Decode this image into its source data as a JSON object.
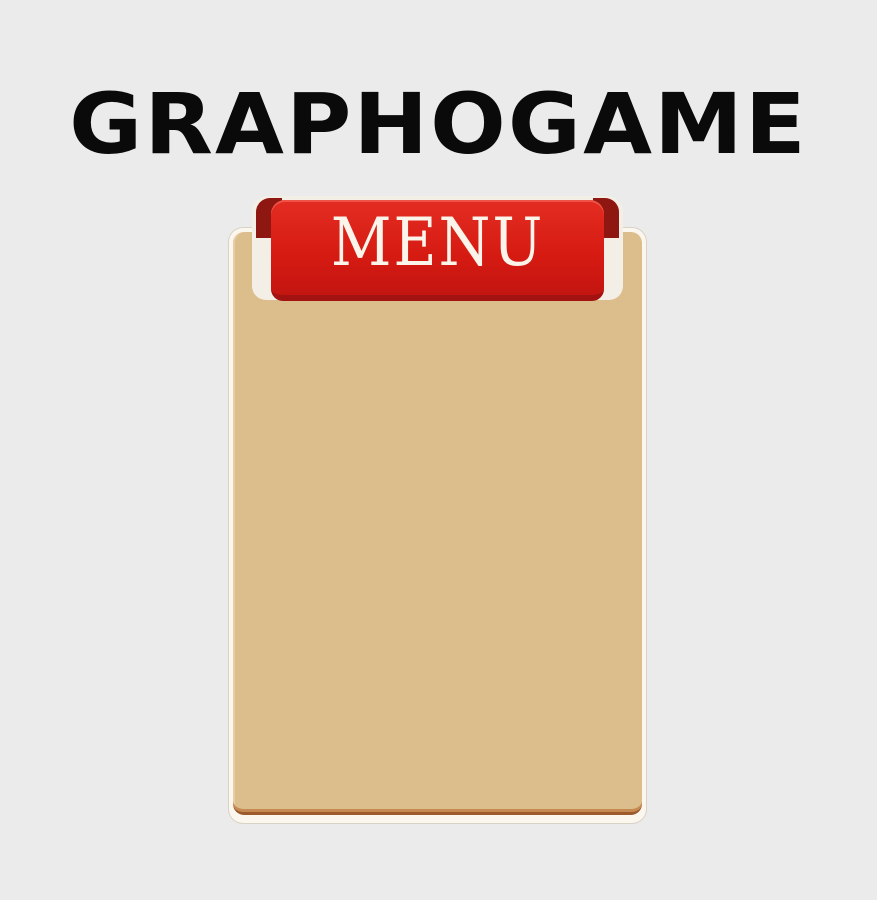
{
  "title": "GRAPHOGAME",
  "menu": {
    "tab_label": "MENU"
  },
  "colors": {
    "background": "#ebebeb",
    "title": "#0a0a0a",
    "board": "#dcbd8c",
    "tab": "#d51a12",
    "tab_text": "#fbf4ea"
  }
}
